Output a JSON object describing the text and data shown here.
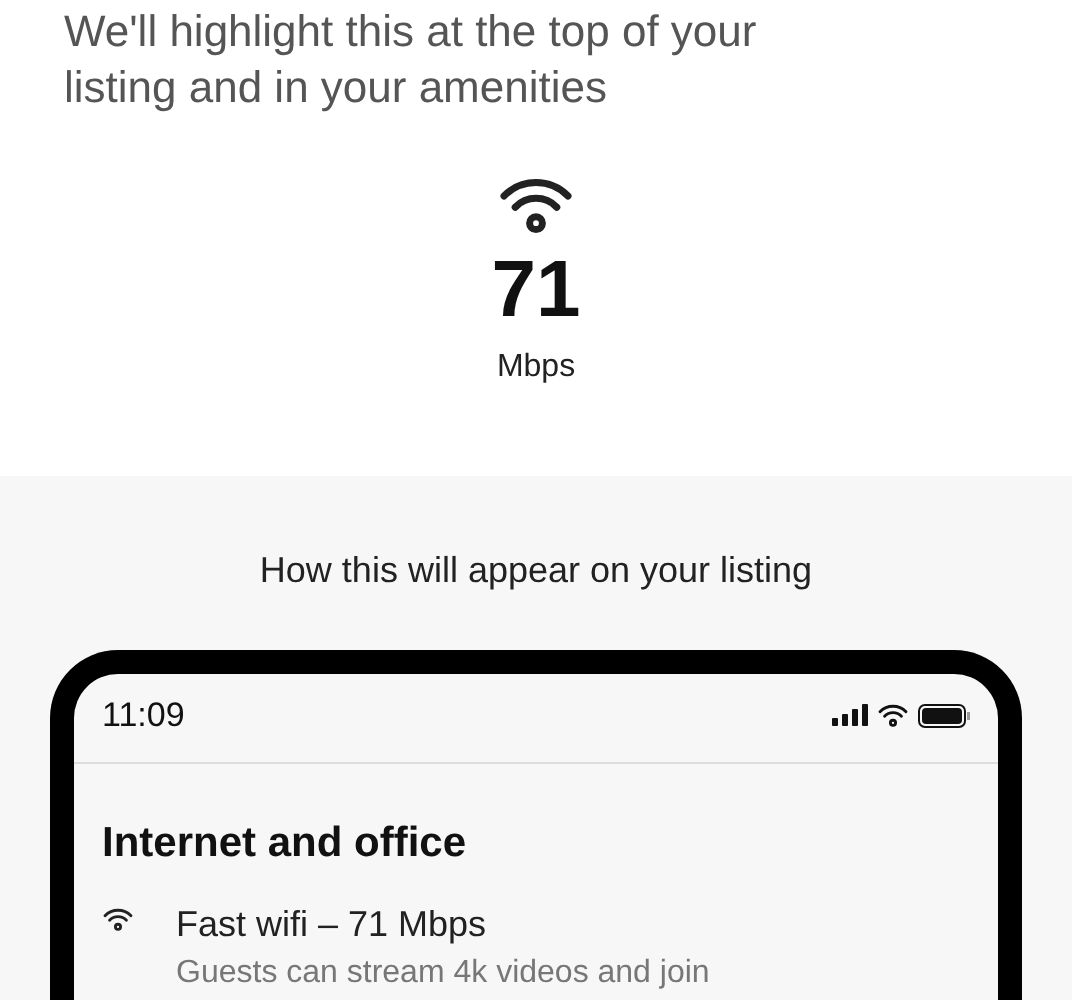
{
  "intro": {
    "text": "We'll highlight this at the top of your listing and in your amenities"
  },
  "speed": {
    "value": "71",
    "unit": "Mbps"
  },
  "preview": {
    "heading": "How this will appear on your listing",
    "phone": {
      "time": "11:09",
      "section_title": "Internet and office",
      "amenity": {
        "title": "Fast wifi – 71 Mbps",
        "description": "Guests can stream 4k videos and join"
      }
    }
  }
}
